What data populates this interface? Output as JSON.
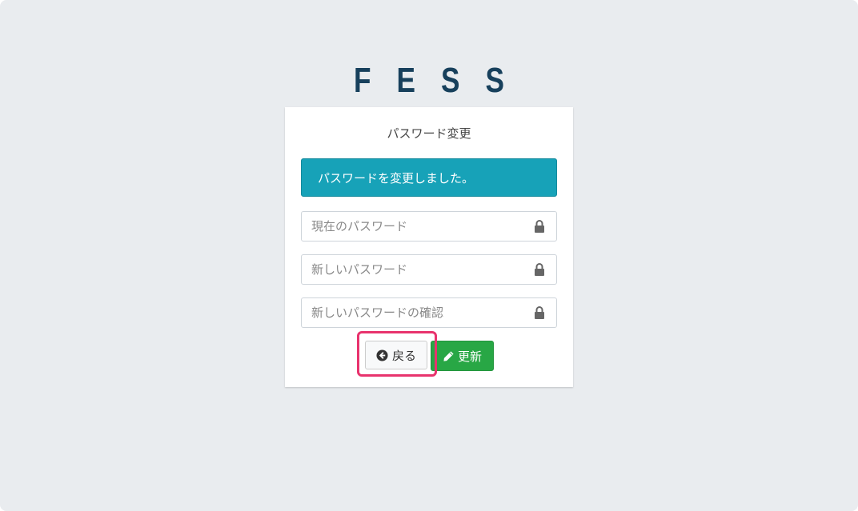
{
  "logo": {
    "text": "FESS"
  },
  "form": {
    "title": "パスワード変更",
    "alert": "パスワードを変更しました。",
    "fields": [
      {
        "placeholder": "現在のパスワード",
        "value": "",
        "icon": "lock-icon"
      },
      {
        "placeholder": "新しいパスワード",
        "value": "",
        "icon": "lock-icon"
      },
      {
        "placeholder": "新しいパスワードの確認",
        "value": "",
        "icon": "lock-icon"
      }
    ],
    "back_label": "戻る",
    "back_icon": "arrow-circle-left-icon",
    "update_label": "更新",
    "update_icon": "pencil-icon"
  },
  "colors": {
    "background": "#e9ecef",
    "logo": "#17405c",
    "alert": "#17a2b8",
    "update_button": "#28a745",
    "highlight": "#e8336d"
  }
}
